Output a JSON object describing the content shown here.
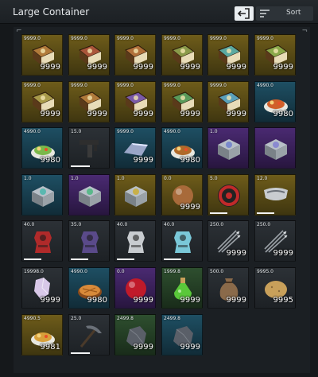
{
  "window": {
    "title": "Large Container"
  },
  "toolbar": {
    "sort_label": "Sort",
    "exit_icon": "exit-icon",
    "sort_icon": "sort-icon"
  },
  "slots": [
    {
      "weight": "9999.0",
      "qty": "9999",
      "rarity": "gold",
      "icon": "book",
      "color": "#b07a3a",
      "dur": null
    },
    {
      "weight": "9999.0",
      "qty": "9999",
      "rarity": "gold",
      "icon": "book",
      "color": "#a9553a",
      "dur": null
    },
    {
      "weight": "9999.0",
      "qty": "9999",
      "rarity": "gold",
      "icon": "book",
      "color": "#b0703a",
      "dur": null
    },
    {
      "weight": "9999.0",
      "qty": "9999",
      "rarity": "gold",
      "icon": "book",
      "color": "#8a9a4a",
      "dur": null
    },
    {
      "weight": "9999.0",
      "qty": "9999",
      "rarity": "gold",
      "icon": "book",
      "color": "#5aa8a0",
      "dur": null
    },
    {
      "weight": "9999.0",
      "qty": "9999",
      "rarity": "gold",
      "icon": "book",
      "color": "#8aa84a",
      "dur": null
    },
    {
      "weight": "9999.0",
      "qty": "9999",
      "rarity": "gold",
      "icon": "book",
      "color": "#a89a4a",
      "dur": null
    },
    {
      "weight": "9999.0",
      "qty": "9999",
      "rarity": "gold",
      "icon": "book",
      "color": "#b07a3a",
      "dur": null
    },
    {
      "weight": "9999.0",
      "qty": "9999",
      "rarity": "gold",
      "icon": "book",
      "color": "#7a5aa8",
      "dur": null
    },
    {
      "weight": "9999.0",
      "qty": "9999",
      "rarity": "gold",
      "icon": "book",
      "color": "#5a9a5a",
      "dur": null
    },
    {
      "weight": "9999.0",
      "qty": "9999",
      "rarity": "gold",
      "icon": "book",
      "color": "#5aa0b8",
      "dur": null
    },
    {
      "weight": "4990.0",
      "qty": "9980",
      "rarity": "blue",
      "icon": "dish",
      "color": "#d0602a",
      "dur": null
    },
    {
      "weight": "4990.0",
      "qty": "9980",
      "rarity": "blue",
      "icon": "dish",
      "color": "#7ab84a",
      "dur": null
    },
    {
      "weight": "15.0",
      "qty": "",
      "rarity": "gray",
      "icon": "gun",
      "color": "#3a3a3a",
      "dur": 0.5
    },
    {
      "weight": "9999.0",
      "qty": "9999",
      "rarity": "blue",
      "icon": "ingot",
      "color": "#9aa6c8",
      "dur": null
    },
    {
      "weight": "4990.0",
      "qty": "9980",
      "rarity": "blue",
      "icon": "dish",
      "color": "#b06a2a",
      "dur": null
    },
    {
      "weight": "1.0",
      "qty": "",
      "rarity": "purple",
      "icon": "crate",
      "color": "#7a8acc",
      "dur": null
    },
    {
      "weight": "",
      "qty": "",
      "rarity": "purple",
      "icon": "crate",
      "color": "#8a8ad0",
      "dur": null
    },
    {
      "weight": "1.0",
      "qty": "",
      "rarity": "blue",
      "icon": "crate",
      "color": "#5ab8b0",
      "dur": null
    },
    {
      "weight": "1.0",
      "qty": "",
      "rarity": "purple",
      "icon": "crate",
      "color": "#5ab88a",
      "dur": null
    },
    {
      "weight": "1.0",
      "qty": "",
      "rarity": "gold",
      "icon": "crate",
      "color": "#c8b04a",
      "dur": null
    },
    {
      "weight": "0.0",
      "qty": "9999",
      "rarity": "gold",
      "icon": "orb",
      "color": "#a86a3a",
      "dur": null
    },
    {
      "weight": "5.0",
      "qty": "",
      "rarity": "gold",
      "icon": "disc",
      "color": "#c02a2a",
      "dur": 0.45
    },
    {
      "weight": "12.0",
      "qty": "",
      "rarity": "gold",
      "icon": "visor",
      "color": "#c8ccd0",
      "dur": 0.45
    },
    {
      "weight": "40.0",
      "qty": "",
      "rarity": "gray",
      "icon": "armor",
      "color": "#b02a2a",
      "dur": 0.45
    },
    {
      "weight": "35.0",
      "qty": "",
      "rarity": "gray",
      "icon": "armor",
      "color": "#5a4a8a",
      "dur": 0.45
    },
    {
      "weight": "40.0",
      "qty": "",
      "rarity": "gray",
      "icon": "armor",
      "color": "#c8ccd0",
      "dur": 0.45
    },
    {
      "weight": "40.0",
      "qty": "",
      "rarity": "gray",
      "icon": "armor",
      "color": "#7ac8d8",
      "dur": 0.45
    },
    {
      "weight": "250.0",
      "qty": "9999",
      "rarity": "gray",
      "icon": "arrows",
      "color": "#9aa0a6",
      "dur": null
    },
    {
      "weight": "250.0",
      "qty": "9999",
      "rarity": "gray",
      "icon": "arrows",
      "color": "#9aa0a6",
      "dur": null
    },
    {
      "weight": "19998.0",
      "qty": "9999",
      "rarity": "gray",
      "icon": "crystal",
      "color": "#d8c8e8",
      "dur": null
    },
    {
      "weight": "4990.0",
      "qty": "9980",
      "rarity": "blue",
      "icon": "pie",
      "color": "#d88a3a",
      "dur": null
    },
    {
      "weight": "0.0",
      "qty": "9999",
      "rarity": "purple",
      "icon": "orb",
      "color": "#c01a2a",
      "dur": null
    },
    {
      "weight": "1999.8",
      "qty": "9999",
      "rarity": "green",
      "icon": "potion",
      "color": "#5ac83a",
      "dur": null
    },
    {
      "weight": "500.0",
      "qty": "9999",
      "rarity": "gray",
      "icon": "sack",
      "color": "#8a6a4a",
      "dur": null
    },
    {
      "weight": "9995.0",
      "qty": "9995",
      "rarity": "gray",
      "icon": "potato",
      "color": "#c8a05a",
      "dur": null
    },
    {
      "weight": "4990.5",
      "qty": "9981",
      "rarity": "gold",
      "icon": "dish",
      "color": "#d8a03a",
      "dur": null
    },
    {
      "weight": "25.0",
      "qty": "",
      "rarity": "gray",
      "icon": "pickaxe",
      "color": "#6a7078",
      "dur": 0.5
    },
    {
      "weight": "2499.8",
      "qty": "9999",
      "rarity": "green",
      "icon": "rock",
      "color": "#5a5f68",
      "dur": null
    },
    {
      "weight": "2499.8",
      "qty": "9999",
      "rarity": "blue",
      "icon": "rock",
      "color": "#5a5f68",
      "dur": null
    }
  ]
}
